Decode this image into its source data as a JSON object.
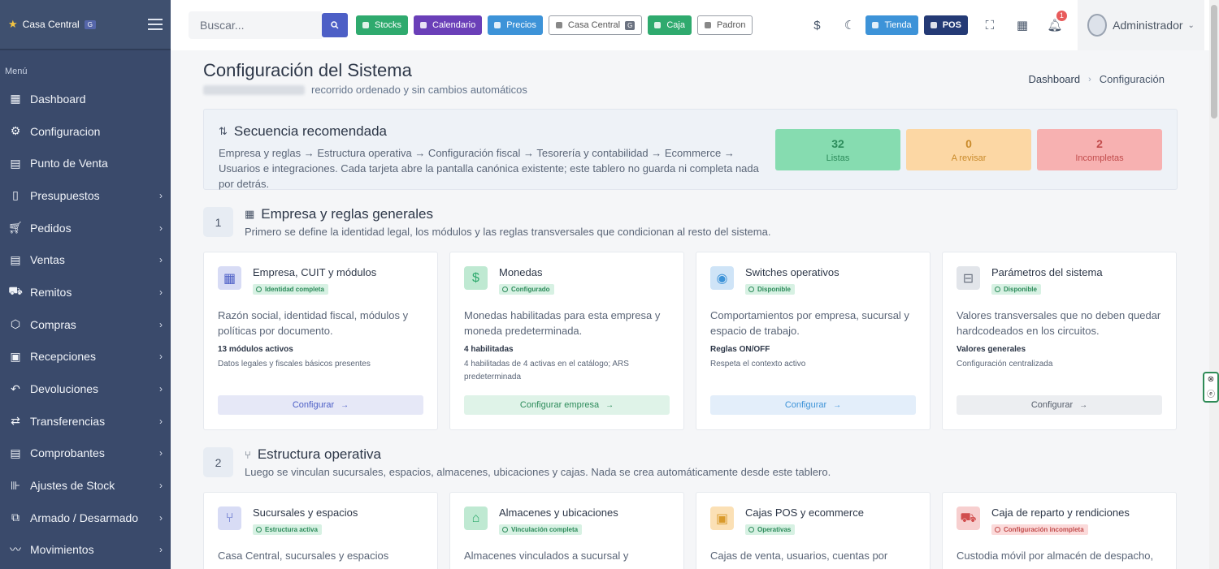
{
  "sidebar": {
    "brand": "Casa Central",
    "brand_badge": "G",
    "menu_label": "Menú",
    "items": [
      {
        "label": "Dashboard",
        "icon": "dashboard-icon",
        "chevron": false
      },
      {
        "label": "Configuracion",
        "icon": "gear-icon",
        "chevron": false
      },
      {
        "label": "Punto de Venta",
        "icon": "pos-icon",
        "chevron": false
      },
      {
        "label": "Presupuestos",
        "icon": "document-icon",
        "chevron": true
      },
      {
        "label": "Pedidos",
        "icon": "cart-icon",
        "chevron": true
      },
      {
        "label": "Ventas",
        "icon": "sales-icon",
        "chevron": true
      },
      {
        "label": "Remitos",
        "icon": "truck-icon",
        "chevron": true
      },
      {
        "label": "Compras",
        "icon": "box-icon",
        "chevron": true
      },
      {
        "label": "Recepciones",
        "icon": "inbox-icon",
        "chevron": true
      },
      {
        "label": "Devoluciones",
        "icon": "return-icon",
        "chevron": true
      },
      {
        "label": "Transferencias",
        "icon": "transfer-icon",
        "chevron": true
      },
      {
        "label": "Comprobantes",
        "icon": "receipt-icon",
        "chevron": true
      },
      {
        "label": "Ajustes de Stock",
        "icon": "adjust-icon",
        "chevron": true
      },
      {
        "label": "Armado / Desarmado",
        "icon": "assemble-icon",
        "chevron": true
      },
      {
        "label": "Movimientos",
        "icon": "chart-line-icon",
        "chevron": true
      }
    ]
  },
  "topbar": {
    "search_placeholder": "Buscar...",
    "buttons": [
      {
        "label": "Stocks",
        "color": "#2faa6e"
      },
      {
        "label": "Calendario",
        "color": "#6a3fb8"
      },
      {
        "label": "Precios",
        "color": "#3d93d8"
      }
    ],
    "branch_label": "Casa Central",
    "branch_badge": "G",
    "caja_label": "Caja",
    "caja_color": "#2faa6e",
    "padron_label": "Padron",
    "tienda_label": "Tienda",
    "tienda_color": "#3d93d8",
    "pos_label": "POS",
    "pos_color": "#243a75",
    "notification_count": "1",
    "user_name": "Administrador"
  },
  "page": {
    "title": "Configuración del Sistema",
    "subtitle": "recorrido ordenado y sin cambios automáticos",
    "breadcrumb": [
      "Dashboard",
      "Configuración"
    ]
  },
  "sequence": {
    "title": "Secuencia recomendada",
    "text": "Empresa y reglas → Estructura operativa → Configuración fiscal → Tesorería y contabilidad → Ecommerce → Usuarios e integraciones. Cada tarjeta abre la pantalla canónica existente; este tablero no guarda ni completa nada por detrás.",
    "stats": [
      {
        "value": "32",
        "label": "Listas",
        "bg": "#86dcb0",
        "color": "#2c8b5a"
      },
      {
        "value": "0",
        "label": "A revisar",
        "bg": "#fcd7a4",
        "color": "#c98a2a"
      },
      {
        "value": "2",
        "label": "Incompletas",
        "bg": "#f7b1b1",
        "color": "#c24c4c"
      }
    ]
  },
  "sections": [
    {
      "number": "1",
      "title": "Empresa y reglas generales",
      "description": "Primero se define la identidad legal, los módulos y las reglas transversales que condicionan al resto del sistema.",
      "cards": [
        {
          "title": "Empresa, CUIT y módulos",
          "badge": "Identidad completa",
          "badge_type": "ok",
          "icon": "building-icon",
          "icon_bg": "#d8dcf5",
          "icon_color": "#4d5fc6",
          "description": "Razón social, identidad fiscal, módulos y políticas por documento.",
          "strong": "13 módulos activos",
          "detail": "Datos legales y fiscales básicos presentes",
          "button": "Configurar",
          "btn_bg": "#e6e8f7",
          "btn_color": "#4d5fc6"
        },
        {
          "title": "Monedas",
          "badge": "Configurado",
          "badge_type": "ok",
          "icon": "dollar-icon",
          "icon_bg": "#bfe9d2",
          "icon_color": "#2faa6e",
          "description": "Monedas habilitadas para esta empresa y moneda predeterminada.",
          "strong": "4 habilitadas",
          "detail": "4 habilitadas de 4 activas en el catálogo; ARS predeterminada",
          "button": "Configurar empresa",
          "btn_bg": "#dff3e8",
          "btn_color": "#2c8b5a"
        },
        {
          "title": "Switches operativos",
          "badge": "Disponible",
          "badge_type": "ok",
          "icon": "toggle-icon",
          "icon_bg": "#cfe4f7",
          "icon_color": "#3d93d8",
          "description": "Comportamientos por empresa, sucursal y espacio de trabajo.",
          "strong": "Reglas ON/OFF",
          "detail": "Respeta el contexto activo",
          "button": "Configurar",
          "btn_bg": "#e3eefa",
          "btn_color": "#3d93d8"
        },
        {
          "title": "Parámetros del sistema",
          "badge": "Disponible",
          "badge_type": "ok",
          "icon": "sliders-icon",
          "icon_bg": "#e2e5ea",
          "icon_color": "#6b7280",
          "description": "Valores transversales que no deben quedar hardcodeados en los circuitos.",
          "strong": "Valores generales",
          "detail": "Configuración centralizada",
          "button": "Configurar",
          "btn_bg": "#eceef1",
          "btn_color": "#555d6a"
        }
      ]
    },
    {
      "number": "2",
      "title": "Estructura operativa",
      "description": "Luego se vinculan sucursales, espacios, almacenes, ubicaciones y cajas. Nada se crea automáticamente desde este tablero.",
      "cards": [
        {
          "title": "Sucursales y espacios",
          "badge": "Estructura activa",
          "badge_type": "ok",
          "icon": "branch-icon",
          "icon_bg": "#d8dcf5",
          "icon_color": "#4d5fc6",
          "description": "Casa Central, sucursales y espacios"
        },
        {
          "title": "Almacenes y ubicaciones",
          "badge": "Vinculación completa",
          "badge_type": "ok",
          "icon": "warehouse-icon",
          "icon_bg": "#bfe9d2",
          "icon_color": "#2faa6e",
          "description": "Almacenes vinculados a sucursal y"
        },
        {
          "title": "Cajas POS y ecommerce",
          "badge": "Operativas",
          "badge_type": "ok",
          "icon": "cashbox-icon",
          "icon_bg": "#fbe0b5",
          "icon_color": "#d99a2b",
          "description": "Cajas de venta, usuarios, cuentas por"
        },
        {
          "title": "Caja de reparto y rendiciones",
          "badge": "Configuración incompleta",
          "badge_type": "bad",
          "icon": "delivery-icon",
          "icon_bg": "#f7cfcf",
          "icon_color": "#d14d4d",
          "description": "Custodia móvil por almacén de despacho,"
        }
      ]
    }
  ]
}
